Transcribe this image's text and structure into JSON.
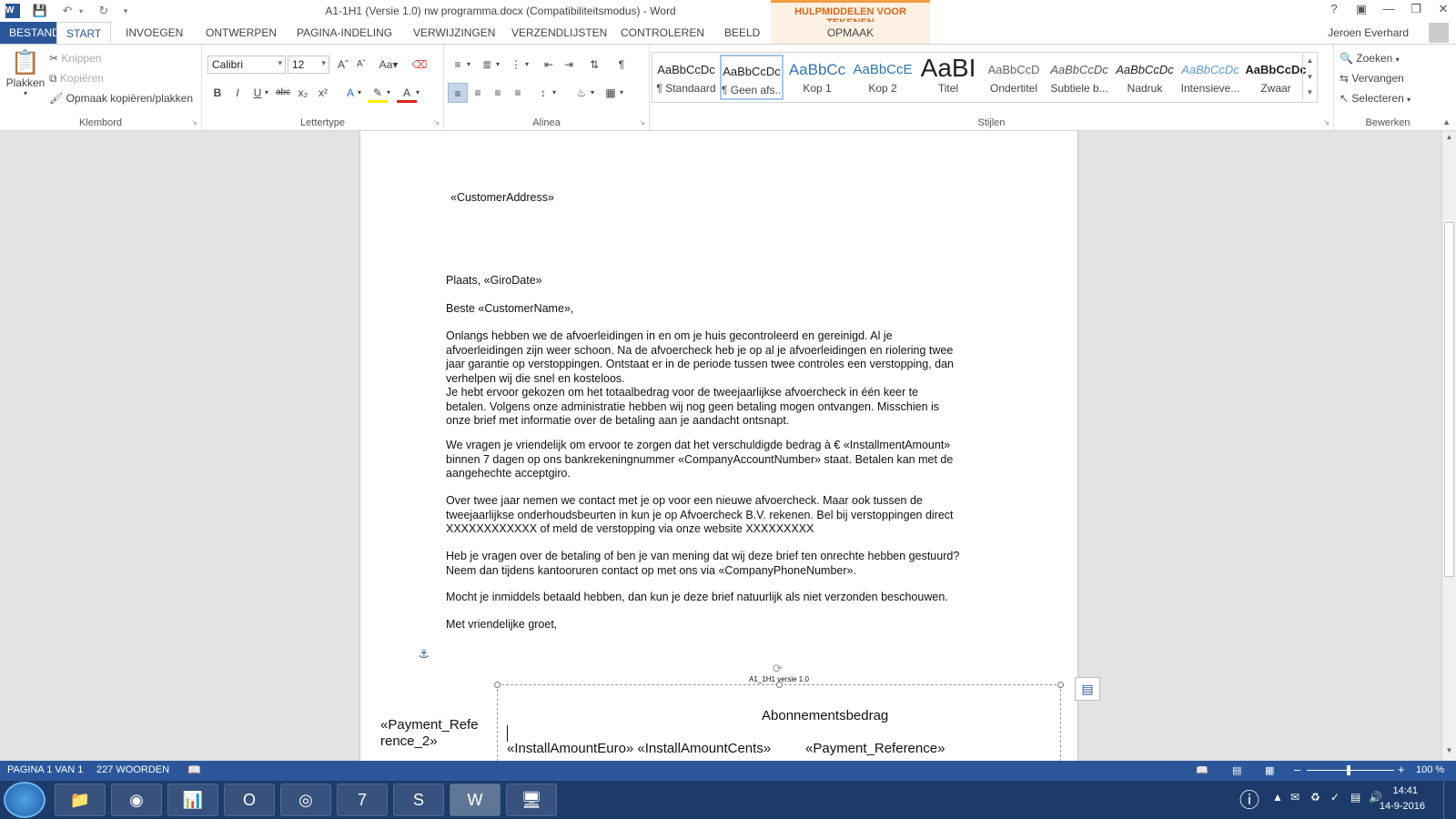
{
  "window": {
    "title": "A1-1H1 (Versie 1.0) nw programma.docx (Compatibiliteitsmodus) - Word",
    "context_tab_group": "HULPMIDDELEN VOOR TEKENEN",
    "context_tab": "OPMAAK",
    "user_name": "Jeroen Everhard"
  },
  "tabs": [
    "BESTAND",
    "START",
    "INVOEGEN",
    "ONTWERPEN",
    "PAGINA-INDELING",
    "VERWIJZINGEN",
    "VERZENDLIJSTEN",
    "CONTROLEREN",
    "BEELD"
  ],
  "ribbon": {
    "clipboard": {
      "label": "Klembord",
      "paste": "Plakken",
      "cut": "Knippen",
      "copy": "Kopiëren",
      "format_painter": "Opmaak kopiëren/plakken"
    },
    "font": {
      "label": "Lettertype",
      "font_name": "Calibri",
      "font_size": "12"
    },
    "paragraph": {
      "label": "Alinea"
    },
    "styles": {
      "label": "Stijlen",
      "items": [
        {
          "sample": "AaBbCcDc",
          "name": "¶ Standaard"
        },
        {
          "sample": "AaBbCcDc",
          "name": "¶ Geen afs..."
        },
        {
          "sample": "AaBbCc",
          "name": "Kop 1"
        },
        {
          "sample": "AaBbCcE",
          "name": "Kop 2"
        },
        {
          "sample": "AaBI",
          "name": "Titel"
        },
        {
          "sample": "AaBbCcD",
          "name": "Ondertitel"
        },
        {
          "sample": "AaBbCcDc",
          "name": "Subtiele b..."
        },
        {
          "sample": "AaBbCcDc",
          "name": "Nadruk"
        },
        {
          "sample": "AaBbCcDc",
          "name": "Intensieve..."
        },
        {
          "sample": "AaBbCcDc",
          "name": "Zwaar"
        }
      ]
    },
    "editing": {
      "label": "Bewerken",
      "find": "Zoeken",
      "replace": "Vervangen",
      "select": "Selecteren"
    }
  },
  "document": {
    "address": "«CustomerAddress»",
    "place_date": "Plaats, «GiroDate»",
    "salutation": "Beste «CustomerName»,",
    "p1": [
      "Onlangs hebben we de afvoerleidingen in en om je huis gecontroleerd en gereinigd. Al je",
      "afvoerleidingen zijn weer schoon. Na de afvoercheck heb je op al je afvoerleidingen en riolering twee",
      "jaar garantie op verstoppingen. Ontstaat er in de periode tussen twee controles een verstopping, dan",
      "verhelpen wij die snel en kosteloos.",
      "Je hebt ervoor gekozen om het totaalbedrag voor de tweejaarlijkse afvoercheck in één keer te",
      "betalen. Volgens onze administratie hebben wij nog geen betaling mogen ontvangen. Misschien is",
      "onze brief met informatie over de betaling aan je aandacht ontsnapt."
    ],
    "p2": [
      "We vragen je vriendelijk om ervoor te zorgen dat het verschuldigde bedrag à € «InstallmentAmount»",
      "binnen 7 dagen op ons bankrekeningnummer «CompanyAccountNumber» staat. Betalen kan met de",
      "aangehechte acceptgiro."
    ],
    "p3": [
      "Over twee jaar nemen we contact met je op voor een nieuwe afvoercheck. Maar ook tussen de",
      "tweejaarlijkse onderhoudsbeurten in kun je op Afvoercheck B.V. rekenen. Bel bij verstoppingen direct",
      "XXXXXXXXXXXX of meld de verstopping via onze website XXXXXXXXX"
    ],
    "p4": [
      "Heb je vragen over de betaling of ben je van mening dat wij deze brief ten onrechte hebben gestuurd?",
      "Neem dan tijdens kantooruren contact op met ons via «CompanyPhoneNumber»."
    ],
    "p5": "Mocht je inmiddels betaald hebben, dan kun je deze brief natuurlijk als niet verzonden beschouwen.",
    "closing": "Met vriendelijke groet,",
    "version_label": "A1_1H1 versie 1.0",
    "subscription_label": "Abonnementsbedrag",
    "payment_ref_left_1": "«Payment_Refe",
    "payment_ref_left_2": "rence_2»",
    "install_amount": "«InstallAmountEuro» «InstallAmountCents»",
    "payment_ref": "«Payment_Reference»"
  },
  "statusbar": {
    "page": "PAGINA 1 VAN 1",
    "words": "227 WOORDEN",
    "zoom": "100 %"
  },
  "taskbar": {
    "time": "14:41",
    "date": "14-9-2016"
  }
}
